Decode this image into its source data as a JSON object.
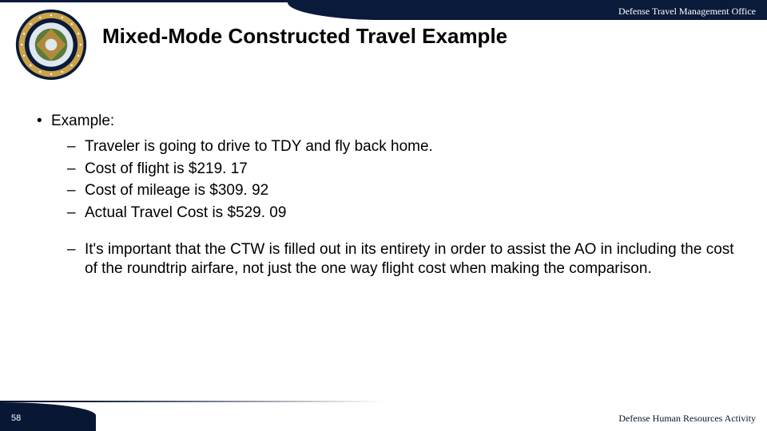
{
  "header": {
    "org": "Defense Travel Management Office"
  },
  "title": "Mixed-Mode Constructed Travel Example",
  "seal": {
    "name": "dod-seal"
  },
  "content": {
    "example_label": "Example:",
    "items": [
      "Traveler is going to drive to TDY and fly back home.",
      "Cost of flight is $219. 17",
      "Cost of mileage is $309. 92",
      "Actual Travel Cost is $529. 09"
    ],
    "note": "It's important that the CTW is filled out in its entirety in order to assist the AO in including the cost of the roundtrip airfare, not just the one way flight cost when making the comparison."
  },
  "footer": {
    "page": "58",
    "org": "Defense Human Resources Activity"
  }
}
